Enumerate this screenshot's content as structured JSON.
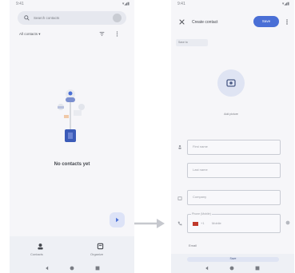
{
  "left": {
    "status_time": "9:41",
    "status_right": "▾◢▮",
    "search_placeholder": "Search contacts",
    "account_label": "All contacts ▾",
    "empty_title": "No contacts yet",
    "bottom_nav": [
      {
        "label": "Contacts",
        "icon": "contacts-icon"
      },
      {
        "label": "Organize",
        "icon": "organize-icon"
      }
    ]
  },
  "right": {
    "status_time": "9:41",
    "status_right": "▾◢▮",
    "title": "Create contact",
    "save_label": "Save",
    "account_chip": "Save to",
    "add_picture_label": "Add picture",
    "fields": {
      "first_name": "First name",
      "last_name": "Last name",
      "company": "Company",
      "phone_caption": "Phone (Mobile)",
      "phone_country": "+1",
      "phone_label": "Mobile",
      "email": "Email"
    },
    "footer_button": "Save"
  },
  "colors": {
    "accent": "#4a6fd6",
    "surface": "#f6f6f9",
    "pill": "#e6e8ef",
    "arrow": "#c6c8ce"
  }
}
